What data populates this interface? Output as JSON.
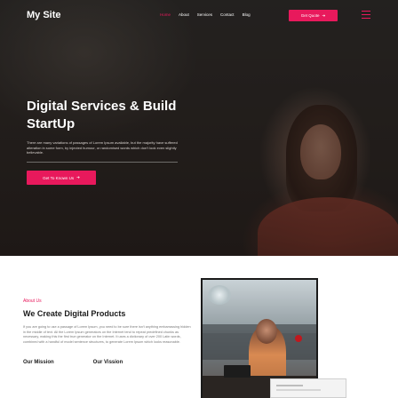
{
  "nav": {
    "logo": "My Site",
    "links": [
      "Home",
      "About",
      "Services",
      "Contact",
      "Blog"
    ],
    "quote_button": "Get Quote",
    "arrow": "➜"
  },
  "hero": {
    "title": "Digital Services & Build StartUp",
    "description": "There are many variations of passages of Lorem Ipsum available, but the majority have suffered alteration in some form, by injected humour, or randomised words which don't look even slightly believable.",
    "button": "Get To Known Us",
    "arrow": "➜"
  },
  "about": {
    "kicker": "About Us",
    "title": "We Create Digital Products",
    "text": "If you are going to use a passage of Lorem Ipsum, you need to be sure there isn't anything embarrassing hidden in the middle of text. All the Lorem Ipsum generators on the Internet tend to repeat predefined chunks as necessary, making this the first true generator on the Internet. It uses a dictionary of over 200 Latin words, combined with a handful of model sentence structures, to generate Lorem Ipsum which looks reasonable.",
    "tabs": [
      "Our Mission",
      "Our Vission"
    ]
  },
  "colors": {
    "accent": "#e8195c",
    "hero_bg": "#2a2523"
  }
}
